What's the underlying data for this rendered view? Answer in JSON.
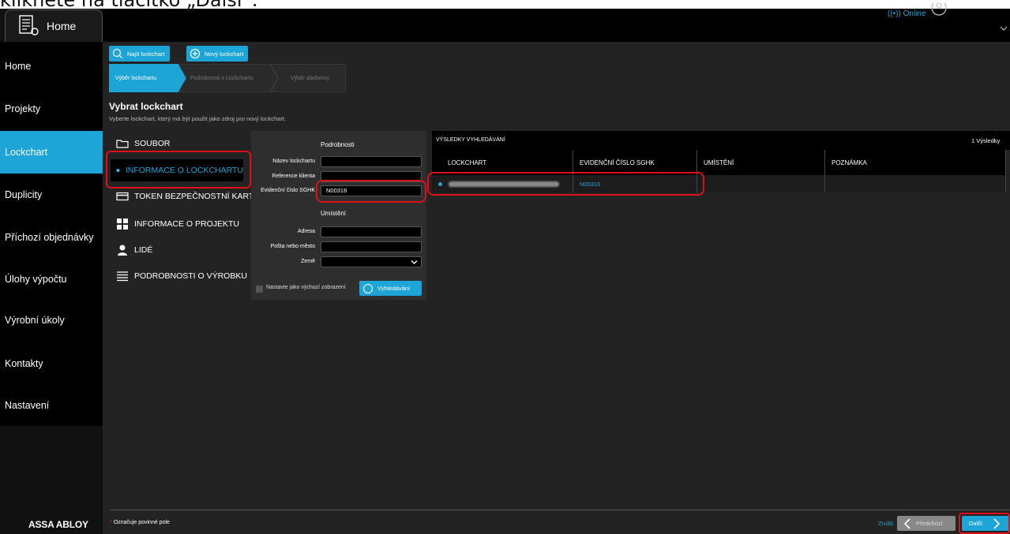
{
  "instruction_caption": "klikněte na tlačítko „Další“.",
  "topbar": {
    "home_tab": "Home",
    "online": "((•)) Online"
  },
  "nav": {
    "items": [
      {
        "label": "Home"
      },
      {
        "label": "Projekty"
      },
      {
        "label": "Lockchart",
        "active": true
      },
      {
        "label": "Duplicity"
      },
      {
        "label": "Příchozí objednávky"
      },
      {
        "label": "Úlohy výpočtu"
      },
      {
        "label": "Výrobní úkoly"
      },
      {
        "label": "Kontakty"
      },
      {
        "label": "Nastavení"
      }
    ],
    "brand": "ASSA ABLOY"
  },
  "actions": {
    "find": "Najít lockchart",
    "new": "Nový lockchart"
  },
  "breadcrumb": [
    "Výběr lockchartu",
    "Podrobnosti o Lockchartu",
    "Výběr platformy"
  ],
  "page": {
    "title": "Vybrat lockchart",
    "subtitle": "Vyberte lockchart, který má být použit jako zdroj pro nový lockchart."
  },
  "categories": [
    {
      "label": "SOUBOR",
      "icon": "folder-icon"
    },
    {
      "label": "INFORMACE O LOCKCHARTU",
      "icon": "info-icon",
      "active": true
    },
    {
      "label": "TOKEN BEZPEČNOSTNÍ KARTY",
      "icon": "card-icon"
    },
    {
      "label": "INFORMACE O PROJEKTU",
      "icon": "project-icon"
    },
    {
      "label": "LIDÉ",
      "icon": "person-icon"
    },
    {
      "label": "PODROBNOSTI O VÝROBKU",
      "icon": "list-icon"
    }
  ],
  "form": {
    "details_heading": "Podrobnosti",
    "lockchart_name_label": "Název lockchartu",
    "lockchart_name_value": "",
    "client_ref_label": "Reference klienta",
    "client_ref_value": "",
    "sghk_label": "Evidenční číslo SGHK",
    "sghk_value": "N00316",
    "location_heading": "Umístění",
    "address_label": "Adresa",
    "address_value": "",
    "post_label": "Pošta nebo město",
    "post_value": "",
    "country_label": "Země",
    "country_value": "",
    "default_view_label": "Nastavte jako výchozí zobrazení",
    "search_button": "Vyhledávání"
  },
  "results": {
    "heading": "VÝSLEDKY VYHLEDÁVÁNÍ",
    "count": "1 Výsledky",
    "columns": [
      "LOCKCHART",
      "EVIDENČNÍ ČÍSLO SGHK",
      "UMÍSTĚNÍ",
      "POZNÁMKA"
    ],
    "rows": [
      {
        "lockchart": "",
        "sghk": "N00316",
        "location": "",
        "note": ""
      }
    ]
  },
  "footer": {
    "required_marker": "*",
    "required_note": "Označuje povinné pole",
    "cancel": "Zrušit",
    "previous": "Předchozí",
    "next": "Další"
  },
  "colors": {
    "accent": "#1ea5d8",
    "highlight": "#e0101a"
  }
}
